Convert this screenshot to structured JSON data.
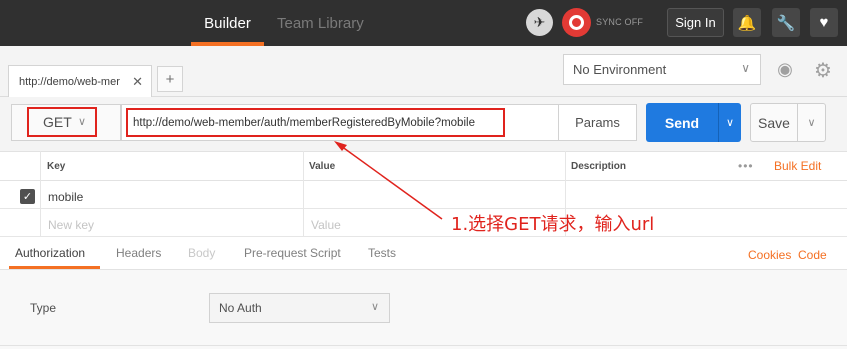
{
  "header": {
    "tabs": [
      {
        "label": "Builder"
      },
      {
        "label": "Team Library"
      }
    ],
    "sync_label": "SYNC OFF",
    "signin_label": "Sign In",
    "icons": [
      "satellite-icon",
      "sync-icon",
      "bell-icon",
      "wrench-icon",
      "heart-icon"
    ]
  },
  "tabstrip": {
    "request_tab_label": "http://demo/web-mer",
    "environment": "No Environment"
  },
  "request": {
    "method": "GET",
    "url": "http://demo/web-member/auth/memberRegisteredByMobile?mobile",
    "params_label": "Params",
    "send_label": "Send",
    "save_label": "Save"
  },
  "params_table": {
    "headers": {
      "key": "Key",
      "value": "Value",
      "description": "Description"
    },
    "bulk_edit": "Bulk Edit",
    "rows": [
      {
        "key": "mobile",
        "value": "",
        "description": "",
        "checked": true
      }
    ],
    "new_row": {
      "key_placeholder": "New key",
      "value_placeholder": "Value"
    }
  },
  "annotation": "1.选择GET请求，输入url",
  "subtabs": {
    "items": [
      {
        "label": "Authorization"
      },
      {
        "label": "Headers"
      },
      {
        "label": "Body"
      },
      {
        "label": "Pre-request Script"
      },
      {
        "label": "Tests"
      }
    ],
    "cookies": "Cookies",
    "code": "Code"
  },
  "auth": {
    "type_label": "Type",
    "type_value": "No Auth"
  },
  "colors": {
    "accent": "#f47023",
    "send_blue": "#1f7ae0",
    "highlight_red": "#e0231d",
    "topbar": "#303030"
  }
}
